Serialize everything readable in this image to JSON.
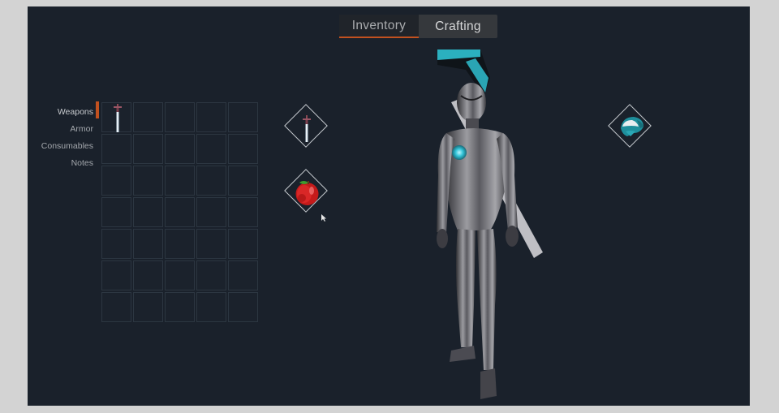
{
  "tabs": [
    {
      "label": "Inventory",
      "active": true
    },
    {
      "label": "Crafting",
      "active": false
    }
  ],
  "categories": [
    {
      "label": "Weapons",
      "active": true
    },
    {
      "label": "Armor",
      "active": false
    },
    {
      "label": "Consumables",
      "active": false
    },
    {
      "label": "Notes",
      "active": false
    }
  ],
  "inventory_grid": {
    "columns": 5,
    "rows": 7,
    "items": [
      {
        "slot": 0,
        "item": "sword-icon"
      }
    ]
  },
  "equipment": {
    "weapon_slot": "sword-icon",
    "consumable_slot": "apple-icon",
    "head_slot": "helmet-icon"
  },
  "colors": {
    "accent": "#c2511f",
    "background": "#1a212b",
    "slot_border": "#2c3641"
  }
}
